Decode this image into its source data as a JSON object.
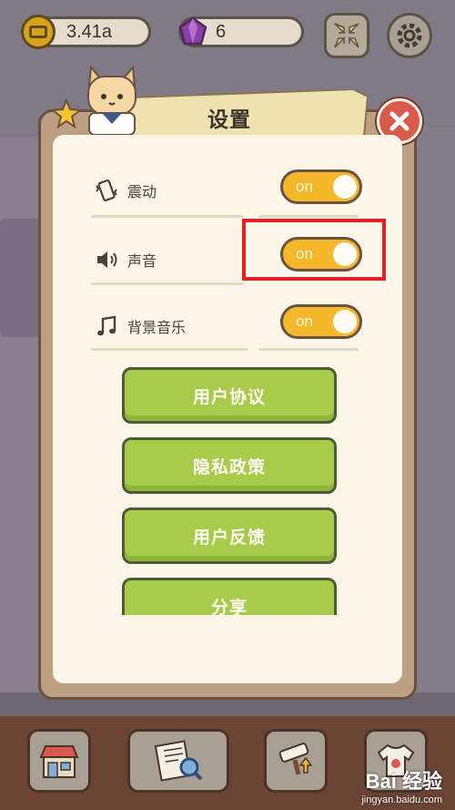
{
  "hud": {
    "coins": "3.41a",
    "gems": "6",
    "icons": [
      "coin-icon",
      "gem-icon",
      "collapse-arrows-icon",
      "gear-icon"
    ]
  },
  "dialog": {
    "title": "设置",
    "settings": [
      {
        "label": "震动",
        "icon": "vibration-icon",
        "toggle": "on"
      },
      {
        "label": "声音",
        "icon": "speaker-icon",
        "toggle": "on"
      },
      {
        "label": "背景音乐",
        "icon": "music-note-icon",
        "toggle": "on"
      }
    ],
    "buttons": [
      "用户协议",
      "隐私政策",
      "用户反馈",
      "分享"
    ]
  },
  "bottom_bar": {
    "icons": [
      "shop-icon",
      "newspaper-search-icon",
      "paint-roller-icon",
      "shirt-icon"
    ]
  },
  "watermark": {
    "brand": "Bai 经验",
    "url": "jingyan.baidu.com"
  },
  "colors": {
    "toggle": "#f4b82a",
    "menu_button": "#a6cc4a",
    "close_button": "#d9594a",
    "highlight": "#e0202a"
  }
}
